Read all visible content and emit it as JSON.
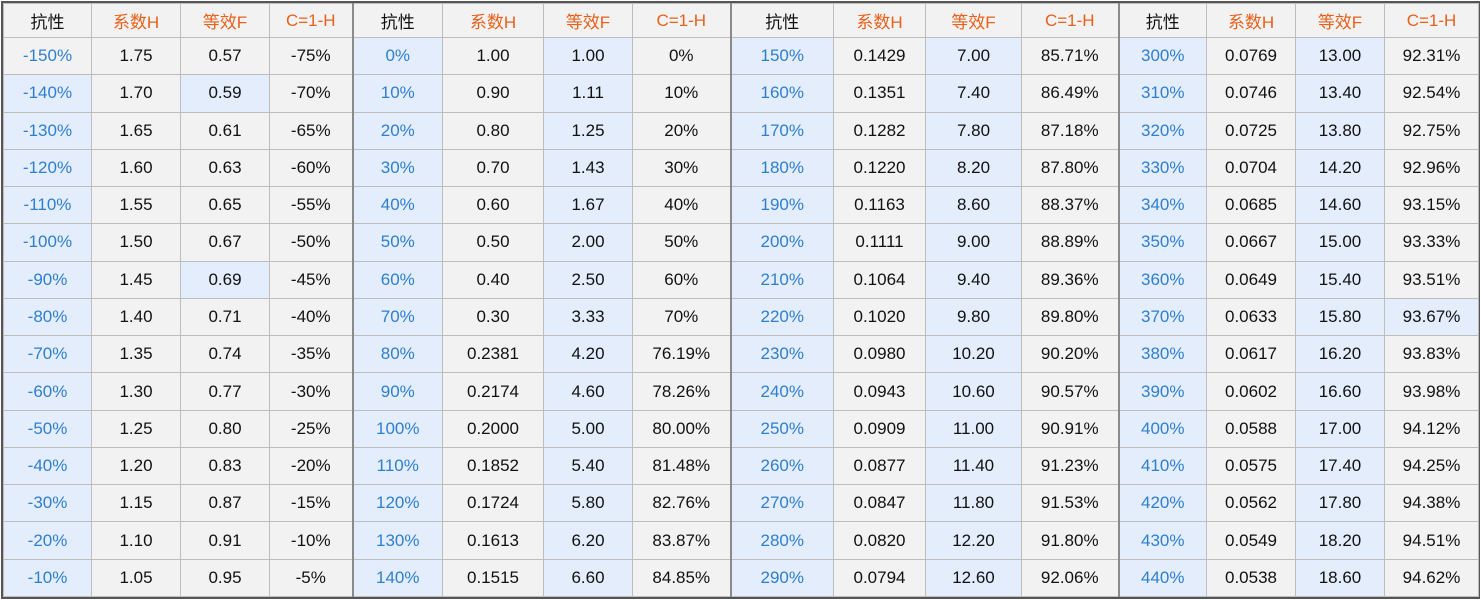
{
  "headers": [
    "抗性",
    "系数H",
    "等效F",
    "C=1-H",
    "抗性",
    "系数H",
    "等效F",
    "C=1-H",
    "抗性",
    "系数H",
    "等效F",
    "C=1-H",
    "抗性",
    "系数H",
    "等效F",
    "C=1-H"
  ],
  "rows": [
    [
      "-150%",
      "1.75",
      "0.57",
      "-75%",
      "0%",
      "1.00",
      "1.00",
      "0%",
      "150%",
      "0.1429",
      "7.00",
      "85.71%",
      "300%",
      "0.0769",
      "13.00",
      "92.31%"
    ],
    [
      "-140%",
      "1.70",
      "0.59",
      "-70%",
      "10%",
      "0.90",
      "1.11",
      "10%",
      "160%",
      "0.1351",
      "7.40",
      "86.49%",
      "310%",
      "0.0746",
      "13.40",
      "92.54%"
    ],
    [
      "-130%",
      "1.65",
      "0.61",
      "-65%",
      "20%",
      "0.80",
      "1.25",
      "20%",
      "170%",
      "0.1282",
      "7.80",
      "87.18%",
      "320%",
      "0.0725",
      "13.80",
      "92.75%"
    ],
    [
      "-120%",
      "1.60",
      "0.63",
      "-60%",
      "30%",
      "0.70",
      "1.43",
      "30%",
      "180%",
      "0.1220",
      "8.20",
      "87.80%",
      "330%",
      "0.0704",
      "14.20",
      "92.96%"
    ],
    [
      "-110%",
      "1.55",
      "0.65",
      "-55%",
      "40%",
      "0.60",
      "1.67",
      "40%",
      "190%",
      "0.1163",
      "8.60",
      "88.37%",
      "340%",
      "0.0685",
      "14.60",
      "93.15%"
    ],
    [
      "-100%",
      "1.50",
      "0.67",
      "-50%",
      "50%",
      "0.50",
      "2.00",
      "50%",
      "200%",
      "0.1111",
      "9.00",
      "88.89%",
      "350%",
      "0.0667",
      "15.00",
      "93.33%"
    ],
    [
      "-90%",
      "1.45",
      "0.69",
      "-45%",
      "60%",
      "0.40",
      "2.50",
      "60%",
      "210%",
      "0.1064",
      "9.40",
      "89.36%",
      "360%",
      "0.0649",
      "15.40",
      "93.51%"
    ],
    [
      "-80%",
      "1.40",
      "0.71",
      "-40%",
      "70%",
      "0.30",
      "3.33",
      "70%",
      "220%",
      "0.1020",
      "9.80",
      "89.80%",
      "370%",
      "0.0633",
      "15.80",
      "93.67%"
    ],
    [
      "-70%",
      "1.35",
      "0.74",
      "-35%",
      "80%",
      "0.2381",
      "4.20",
      "76.19%",
      "230%",
      "0.0980",
      "10.20",
      "90.20%",
      "380%",
      "0.0617",
      "16.20",
      "93.83%"
    ],
    [
      "-60%",
      "1.30",
      "0.77",
      "-30%",
      "90%",
      "0.2174",
      "4.60",
      "78.26%",
      "240%",
      "0.0943",
      "10.60",
      "90.57%",
      "390%",
      "0.0602",
      "16.60",
      "93.98%"
    ],
    [
      "-50%",
      "1.25",
      "0.80",
      "-25%",
      "100%",
      "0.2000",
      "5.00",
      "80.00%",
      "250%",
      "0.0909",
      "11.00",
      "90.91%",
      "400%",
      "0.0588",
      "17.00",
      "94.12%"
    ],
    [
      "-40%",
      "1.20",
      "0.83",
      "-20%",
      "110%",
      "0.1852",
      "5.40",
      "81.48%",
      "260%",
      "0.0877",
      "11.40",
      "91.23%",
      "410%",
      "0.0575",
      "17.40",
      "94.25%"
    ],
    [
      "-30%",
      "1.15",
      "0.87",
      "-15%",
      "120%",
      "0.1724",
      "5.80",
      "82.76%",
      "270%",
      "0.0847",
      "11.80",
      "91.53%",
      "420%",
      "0.0562",
      "17.80",
      "94.38%"
    ],
    [
      "-20%",
      "1.10",
      "0.91",
      "-10%",
      "130%",
      "0.1613",
      "6.20",
      "83.87%",
      "280%",
      "0.0820",
      "12.20",
      "91.80%",
      "430%",
      "0.0549",
      "18.20",
      "94.51%"
    ],
    [
      "-10%",
      "1.05",
      "0.95",
      "-5%",
      "140%",
      "0.1515",
      "6.60",
      "84.85%",
      "290%",
      "0.0794",
      "12.60",
      "92.06%",
      "440%",
      "0.0538",
      "18.60",
      "94.62%"
    ]
  ],
  "colors": {
    "header_resistance_text": "#111111",
    "header_coefficient_text": "#e8611a",
    "resistance_value_text": "#2f7fd1",
    "cell_gray": "#f2f2f2",
    "cell_blue": "#e3edfb",
    "border": "#bdbdbd"
  },
  "highlight_cells": [
    [
      0,
      4
    ],
    [
      0,
      6
    ],
    [
      0,
      8
    ],
    [
      0,
      10
    ],
    [
      0,
      12
    ],
    [
      0,
      14
    ],
    [
      1,
      0
    ],
    [
      1,
      2
    ],
    [
      1,
      4
    ],
    [
      1,
      6
    ],
    [
      1,
      8
    ],
    [
      1,
      10
    ],
    [
      1,
      12
    ],
    [
      1,
      14
    ],
    [
      2,
      0
    ],
    [
      2,
      4
    ],
    [
      2,
      6
    ],
    [
      2,
      8
    ],
    [
      2,
      10
    ],
    [
      2,
      12
    ],
    [
      2,
      14
    ],
    [
      3,
      0
    ],
    [
      3,
      4
    ],
    [
      3,
      6
    ],
    [
      3,
      8
    ],
    [
      3,
      10
    ],
    [
      3,
      12
    ],
    [
      3,
      14
    ],
    [
      4,
      0
    ],
    [
      4,
      4
    ],
    [
      4,
      6
    ],
    [
      4,
      8
    ],
    [
      4,
      10
    ],
    [
      4,
      12
    ],
    [
      4,
      14
    ],
    [
      5,
      0
    ],
    [
      5,
      4
    ],
    [
      5,
      6
    ],
    [
      5,
      8
    ],
    [
      5,
      10
    ],
    [
      5,
      12
    ],
    [
      5,
      14
    ],
    [
      6,
      0
    ],
    [
      6,
      2
    ],
    [
      6,
      4
    ],
    [
      6,
      6
    ],
    [
      6,
      8
    ],
    [
      6,
      10
    ],
    [
      6,
      12
    ],
    [
      6,
      14
    ],
    [
      7,
      0
    ],
    [
      7,
      4
    ],
    [
      7,
      6
    ],
    [
      7,
      8
    ],
    [
      7,
      10
    ],
    [
      7,
      12
    ],
    [
      7,
      14
    ],
    [
      7,
      15
    ],
    [
      8,
      0
    ],
    [
      8,
      4
    ],
    [
      8,
      6
    ],
    [
      8,
      8
    ],
    [
      8,
      10
    ],
    [
      8,
      12
    ],
    [
      8,
      14
    ],
    [
      9,
      0
    ],
    [
      9,
      4
    ],
    [
      9,
      6
    ],
    [
      9,
      8
    ],
    [
      9,
      10
    ],
    [
      9,
      12
    ],
    [
      9,
      14
    ],
    [
      10,
      0
    ],
    [
      10,
      4
    ],
    [
      10,
      6
    ],
    [
      10,
      8
    ],
    [
      10,
      10
    ],
    [
      10,
      12
    ],
    [
      10,
      14
    ],
    [
      11,
      0
    ],
    [
      11,
      4
    ],
    [
      11,
      6
    ],
    [
      11,
      8
    ],
    [
      11,
      10
    ],
    [
      11,
      12
    ],
    [
      11,
      14
    ],
    [
      12,
      0
    ],
    [
      12,
      4
    ],
    [
      12,
      6
    ],
    [
      12,
      8
    ],
    [
      12,
      10
    ],
    [
      12,
      12
    ],
    [
      12,
      14
    ],
    [
      13,
      0
    ],
    [
      13,
      4
    ],
    [
      13,
      6
    ],
    [
      13,
      8
    ],
    [
      13,
      10
    ],
    [
      13,
      12
    ],
    [
      13,
      14
    ],
    [
      14,
      0
    ],
    [
      14,
      4
    ],
    [
      14,
      6
    ],
    [
      14,
      8
    ],
    [
      14,
      10
    ],
    [
      14,
      12
    ],
    [
      14,
      14
    ]
  ]
}
